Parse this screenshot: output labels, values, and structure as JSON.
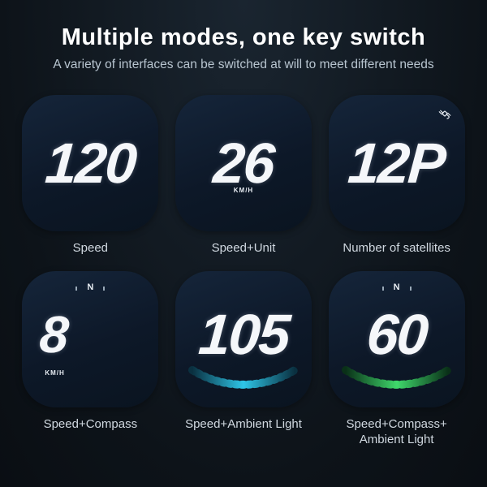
{
  "header": {
    "title": "Multiple modes, one key switch",
    "subtitle": "A variety of interfaces can be switched at will to meet different needs"
  },
  "tiles": {
    "speed": {
      "value": "120",
      "caption": "Speed"
    },
    "speed_unit": {
      "value": "26",
      "unit": "KM/H",
      "caption": "Speed+Unit"
    },
    "satellites": {
      "value": "12P",
      "caption": "Number of satellites"
    },
    "speed_compass": {
      "value": "8",
      "unit": "KM/H",
      "compass": "N",
      "caption": "Speed+Compass"
    },
    "speed_ambient": {
      "value": "105",
      "caption": "Speed+Ambient Light"
    },
    "speed_compass_ambient": {
      "value": "60",
      "compass": "N",
      "caption": "Speed+Compass+\nAmbient Light"
    }
  },
  "colors": {
    "arc_blue": "#2ec6e8",
    "arc_green": "#3fd86b"
  }
}
